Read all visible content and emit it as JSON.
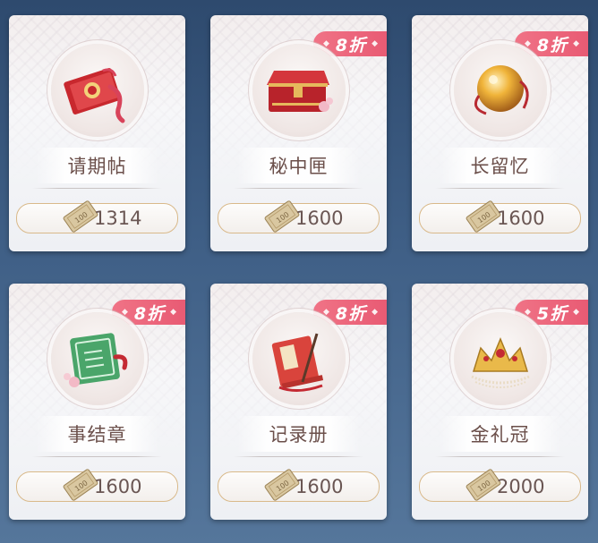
{
  "colors": {
    "badge": "#ea6077",
    "price_border": "#d9b98a",
    "name_text": "#6b4f4a"
  },
  "currency_icon": "ticket-coupon-icon",
  "currency_ticket_text": "100",
  "items": [
    {
      "name": "请期帖",
      "price": "1314",
      "discount": null,
      "icon": "red-invitation-icon"
    },
    {
      "name": "秘中匣",
      "price": "1600",
      "discount": "8折",
      "icon": "red-chest-icon"
    },
    {
      "name": "长留忆",
      "price": "1600",
      "discount": "8折",
      "icon": "golden-orb-icon"
    },
    {
      "name": "事结章",
      "price": "1600",
      "discount": "8折",
      "icon": "jade-seal-icon"
    },
    {
      "name": "记录册",
      "price": "1600",
      "discount": "8折",
      "icon": "record-book-icon"
    },
    {
      "name": "金礼冠",
      "price": "2000",
      "discount": "5折",
      "icon": "golden-crown-icon"
    }
  ]
}
